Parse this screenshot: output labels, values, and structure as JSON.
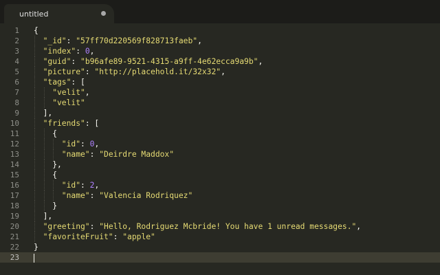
{
  "tab": {
    "title": "untitled",
    "modified_indicator": "dirty-dot-icon"
  },
  "editor": {
    "current_line": 23,
    "lines": [
      {
        "n": "1",
        "indent": 0,
        "text": [
          {
            "t": "{",
            "c": "p"
          }
        ]
      },
      {
        "n": "2",
        "indent": 1,
        "text": [
          {
            "t": "\"_id\"",
            "c": "k"
          },
          {
            "t": ": ",
            "c": "p"
          },
          {
            "t": "\"57ff70d220569f828713faeb\"",
            "c": "s"
          },
          {
            "t": ",",
            "c": "p"
          }
        ]
      },
      {
        "n": "3",
        "indent": 1,
        "text": [
          {
            "t": "\"index\"",
            "c": "k"
          },
          {
            "t": ": ",
            "c": "p"
          },
          {
            "t": "0",
            "c": "n"
          },
          {
            "t": ",",
            "c": "p"
          }
        ]
      },
      {
        "n": "4",
        "indent": 1,
        "text": [
          {
            "t": "\"guid\"",
            "c": "k"
          },
          {
            "t": ": ",
            "c": "p"
          },
          {
            "t": "\"b96afe89-9521-4315-a9ff-4e62ecca9a9b\"",
            "c": "s"
          },
          {
            "t": ",",
            "c": "p"
          }
        ]
      },
      {
        "n": "5",
        "indent": 1,
        "text": [
          {
            "t": "\"picture\"",
            "c": "k"
          },
          {
            "t": ": ",
            "c": "p"
          },
          {
            "t": "\"http://placehold.it/32x32\"",
            "c": "s"
          },
          {
            "t": ",",
            "c": "p"
          }
        ]
      },
      {
        "n": "6",
        "indent": 1,
        "text": [
          {
            "t": "\"tags\"",
            "c": "k"
          },
          {
            "t": ": [",
            "c": "p"
          }
        ]
      },
      {
        "n": "7",
        "indent": 2,
        "text": [
          {
            "t": "\"velit\"",
            "c": "s"
          },
          {
            "t": ",",
            "c": "p"
          }
        ]
      },
      {
        "n": "8",
        "indent": 2,
        "text": [
          {
            "t": "\"velit\"",
            "c": "s"
          }
        ]
      },
      {
        "n": "9",
        "indent": 1,
        "text": [
          {
            "t": "],",
            "c": "p"
          }
        ]
      },
      {
        "n": "10",
        "indent": 1,
        "text": [
          {
            "t": "\"friends\"",
            "c": "k"
          },
          {
            "t": ": [",
            "c": "p"
          }
        ]
      },
      {
        "n": "11",
        "indent": 2,
        "text": [
          {
            "t": "{",
            "c": "p"
          }
        ]
      },
      {
        "n": "12",
        "indent": 3,
        "text": [
          {
            "t": "\"id\"",
            "c": "k"
          },
          {
            "t": ": ",
            "c": "p"
          },
          {
            "t": "0",
            "c": "n"
          },
          {
            "t": ",",
            "c": "p"
          }
        ]
      },
      {
        "n": "13",
        "indent": 3,
        "text": [
          {
            "t": "\"name\"",
            "c": "k"
          },
          {
            "t": ": ",
            "c": "p"
          },
          {
            "t": "\"Deirdre Maddox\"",
            "c": "s"
          }
        ]
      },
      {
        "n": "14",
        "indent": 2,
        "text": [
          {
            "t": "},",
            "c": "p"
          }
        ]
      },
      {
        "n": "15",
        "indent": 2,
        "text": [
          {
            "t": "{",
            "c": "p"
          }
        ]
      },
      {
        "n": "16",
        "indent": 3,
        "text": [
          {
            "t": "\"id\"",
            "c": "k"
          },
          {
            "t": ": ",
            "c": "p"
          },
          {
            "t": "2",
            "c": "n"
          },
          {
            "t": ",",
            "c": "p"
          }
        ]
      },
      {
        "n": "17",
        "indent": 3,
        "text": [
          {
            "t": "\"name\"",
            "c": "k"
          },
          {
            "t": ": ",
            "c": "p"
          },
          {
            "t": "\"Valencia Rodriquez\"",
            "c": "s"
          }
        ]
      },
      {
        "n": "18",
        "indent": 2,
        "text": [
          {
            "t": "}",
            "c": "p"
          }
        ]
      },
      {
        "n": "19",
        "indent": 1,
        "text": [
          {
            "t": "],",
            "c": "p"
          }
        ]
      },
      {
        "n": "20",
        "indent": 1,
        "text": [
          {
            "t": "\"greeting\"",
            "c": "k"
          },
          {
            "t": ": ",
            "c": "p"
          },
          {
            "t": "\"Hello, Rodriguez Mcbride! You have 1 unread messages.\"",
            "c": "s"
          },
          {
            "t": ",",
            "c": "p"
          }
        ]
      },
      {
        "n": "21",
        "indent": 1,
        "text": [
          {
            "t": "\"favoriteFruit\"",
            "c": "k"
          },
          {
            "t": ": ",
            "c": "p"
          },
          {
            "t": "\"apple\"",
            "c": "s"
          }
        ]
      },
      {
        "n": "22",
        "indent": 0,
        "text": [
          {
            "t": "}",
            "c": "p"
          }
        ]
      },
      {
        "n": "23",
        "indent": 0,
        "text": []
      }
    ]
  },
  "colors": {
    "background": "#272822",
    "string": "#e6db74",
    "number": "#ae81ff",
    "punctuation": "#f8f8f2",
    "line_highlight": "#3e3d32",
    "gutter_text": "#8f908a"
  }
}
